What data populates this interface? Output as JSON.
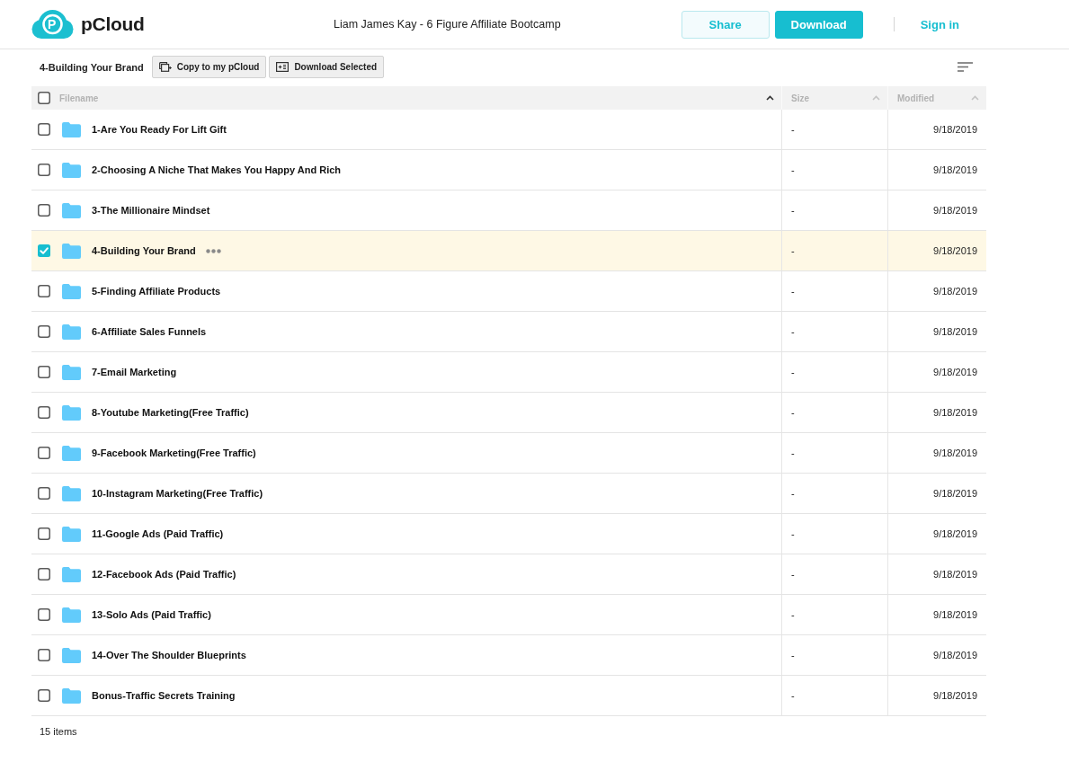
{
  "header": {
    "logo_mark": "P",
    "logo_text": "pCloud",
    "title": "Liam James Kay - 6 Figure Affiliate Bootcamp",
    "buttons": [
      {
        "label": "Share",
        "kind": "outline"
      },
      {
        "label": "Download",
        "kind": "primary"
      }
    ],
    "sign_in": "Sign in"
  },
  "toolbar": {
    "breadcrumb": "4-Building Your Brand",
    "buttons": [
      {
        "label": "Copy to my pCloud",
        "kind": "copy"
      },
      {
        "label": "Download Selected",
        "kind": "download"
      }
    ]
  },
  "table": {
    "select_all": {
      "checked": false
    },
    "columns": [
      {
        "label": "Filename",
        "sorted": true
      },
      {
        "label": "Size",
        "sorted": false
      },
      {
        "label": "Modified",
        "sorted": false
      }
    ],
    "rows": [
      {
        "name": "1-Are You Ready For Lift Gift",
        "size": "-",
        "modified": "9/18/2019",
        "selected": false
      },
      {
        "name": "2-Choosing A Niche That Makes You Happy And Rich",
        "size": "-",
        "modified": "9/18/2019",
        "selected": false
      },
      {
        "name": "3-The Millionaire Mindset",
        "size": "-",
        "modified": "9/18/2019",
        "selected": false
      },
      {
        "name": "4-Building Your Brand",
        "size": "-",
        "modified": "9/18/2019",
        "selected": true
      },
      {
        "name": "5-Finding Affiliate Products",
        "size": "-",
        "modified": "9/18/2019",
        "selected": false
      },
      {
        "name": "6-Affiliate Sales Funnels",
        "size": "-",
        "modified": "9/18/2019",
        "selected": false
      },
      {
        "name": "7-Email Marketing",
        "size": "-",
        "modified": "9/18/2019",
        "selected": false
      },
      {
        "name": "8-Youtube Marketing(Free Traffic)",
        "size": "-",
        "modified": "9/18/2019",
        "selected": false
      },
      {
        "name": "9-Facebook Marketing(Free Traffic)",
        "size": "-",
        "modified": "9/18/2019",
        "selected": false
      },
      {
        "name": "10-Instagram Marketing(Free Traffic)",
        "size": "-",
        "modified": "9/18/2019",
        "selected": false
      },
      {
        "name": "11-Google Ads (Paid Traffic)",
        "size": "-",
        "modified": "9/18/2019",
        "selected": false
      },
      {
        "name": "12-Facebook Ads (Paid Traffic)",
        "size": "-",
        "modified": "9/18/2019",
        "selected": false
      },
      {
        "name": "13-Solo Ads (Paid Traffic)",
        "size": "-",
        "modified": "9/18/2019",
        "selected": false
      },
      {
        "name": "14-Over The Shoulder Blueprints",
        "size": "-",
        "modified": "9/18/2019",
        "selected": false
      },
      {
        "name": "Bonus-Traffic Secrets Training",
        "size": "-",
        "modified": "9/18/2019",
        "selected": false
      }
    ]
  },
  "footer": {
    "count": "15 items"
  }
}
